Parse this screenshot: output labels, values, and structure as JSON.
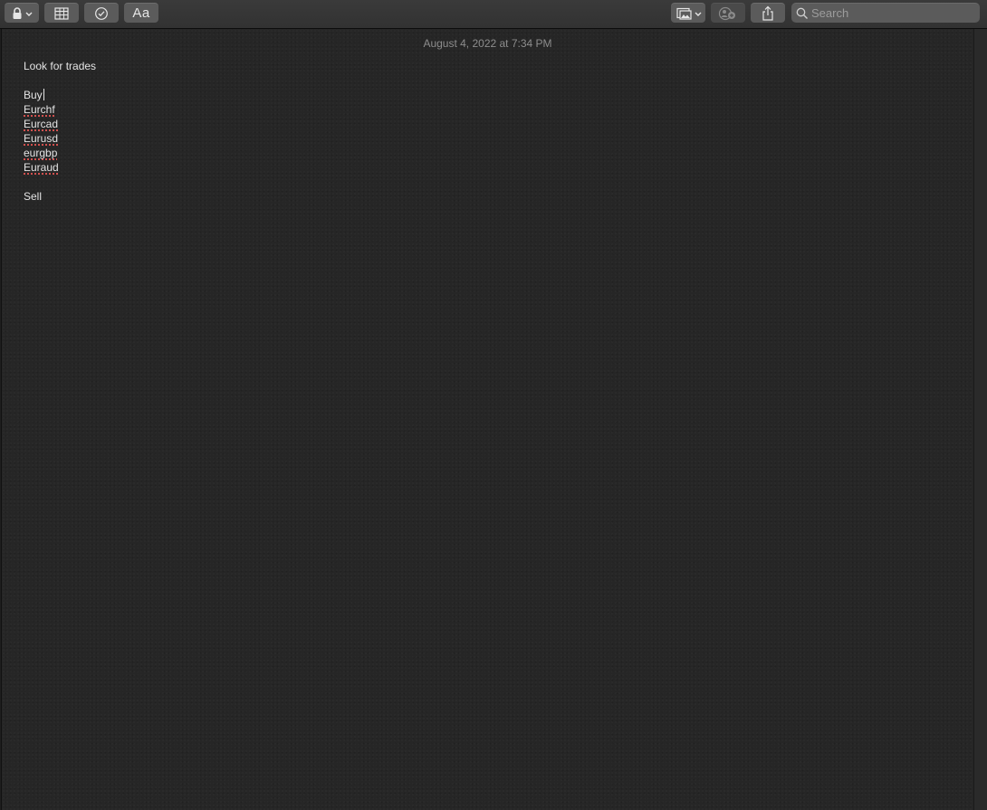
{
  "toolbar": {
    "lock_icon": "lock-icon",
    "table_icon": "table-icon",
    "checklist_icon": "checklist-icon",
    "format_label": "Aa",
    "media_icon": "photo-icon",
    "collaborate_icon": "add-people-icon",
    "share_icon": "share-icon"
  },
  "search": {
    "placeholder": "Search",
    "value": ""
  },
  "note": {
    "date": "August 4, 2022 at 7:34 PM",
    "title": "Look for trades",
    "buy_heading": "Buy",
    "buy_items": [
      "Eurchf",
      "Eurcad",
      "Eurusd",
      "eurgbp",
      "Euraud"
    ],
    "sell_heading": "Sell"
  },
  "colors": {
    "background": "#262626",
    "toolbar": "#353535",
    "button": "#5b5b5b",
    "text": "#e4e4e4",
    "date_text": "#8d8d8d",
    "spellcheck": "#d2514f"
  }
}
